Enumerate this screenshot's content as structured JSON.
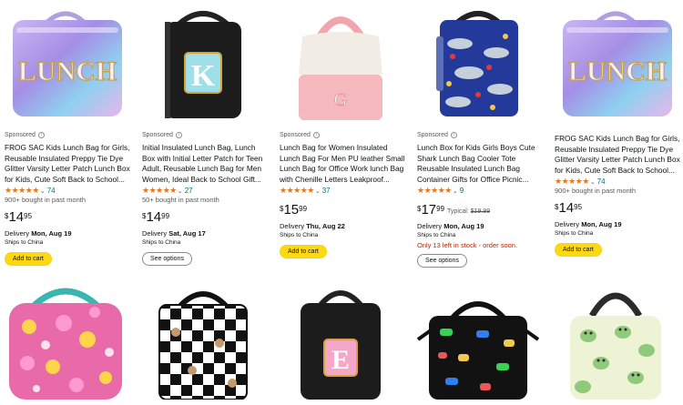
{
  "products": [
    {
      "sponsored": "Sponsored",
      "title": "FROG SAC Kids Lunch Bag for Girls, Reusable Insulated Preppy Tie Dye Glitter Varsity Letter Patch Lunch Box for Kids, Cute Soft Back to School...",
      "stars": "★★★★★",
      "rating": 4.5,
      "reviews": "74",
      "bought": "900+ bought in past month",
      "price_currency": "$",
      "price_whole": "14",
      "price_fraction": "95",
      "typical_label": "",
      "typical_price": "",
      "delivery_label": "Delivery",
      "delivery_date": "Mon, Aug 19",
      "ships": "Ships to China",
      "stock": "",
      "button": "Add to cart"
    },
    {
      "sponsored": "Sponsored",
      "title": "Initial Insulated Lunch Bag, Lunch Box with Initial Letter Patch for Teen Adult, Reusable Lunch Bag for Men Women, Ideal Back to School Gift...",
      "stars": "★★★★★",
      "rating": 4.5,
      "reviews": "27",
      "bought": "50+ bought in past month",
      "price_currency": "$",
      "price_whole": "14",
      "price_fraction": "99",
      "typical_label": "",
      "typical_price": "",
      "delivery_label": "Delivery",
      "delivery_date": "Sat, Aug 17",
      "ships": "Ships to China",
      "stock": "",
      "button": "See options"
    },
    {
      "sponsored": "Sponsored",
      "title": "Lunch Bag for Women Insulated Lunch Bag For Men PU leather Small Lunch Bag for Office Work lunch Bag with Chenille Letters Leakproof...",
      "stars": "★★★★★",
      "rating": 4,
      "reviews": "37",
      "bought": "",
      "price_currency": "$",
      "price_whole": "15",
      "price_fraction": "99",
      "typical_label": "",
      "typical_price": "",
      "delivery_label": "Delivery",
      "delivery_date": "Thu, Aug 22",
      "ships": "Ships to China",
      "stock": "",
      "button": "Add to cart"
    },
    {
      "sponsored": "Sponsored",
      "title": "Lunch Box for Kids Girls Boys Cute Shark Lunch Bag Cooler Tote Reusable Insulated Lunch Bag Container Gifts for Office Picnic...",
      "stars": "★★★★★",
      "rating": 4.5,
      "reviews": "9",
      "bought": "",
      "price_currency": "$",
      "price_whole": "17",
      "price_fraction": "99",
      "typical_label": "Typical:",
      "typical_price": "$19.99",
      "delivery_label": "Delivery",
      "delivery_date": "Mon, Aug 19",
      "ships": "Ships to China",
      "stock": "Only 13 left in stock - order soon.",
      "button": "See options"
    },
    {
      "sponsored": "",
      "title": "FROG SAC Kids Lunch Bag for Girls, Reusable Insulated Preppy Tie Dye Glitter Varsity Letter Patch Lunch Box for Kids, Cute Soft Back to School...",
      "stars": "★★★★★",
      "rating": 4.5,
      "reviews": "74",
      "bought": "900+ bought in past month",
      "price_currency": "$",
      "price_whole": "14",
      "price_fraction": "95",
      "typical_label": "",
      "typical_price": "",
      "delivery_label": "Delivery",
      "delivery_date": "Mon, Aug 19",
      "ships": "Ships to China",
      "stock": "",
      "button": "Add to cart"
    }
  ],
  "images": {
    "lunch_text": "LUNCH",
    "k_letter": "K",
    "g_letter": "G",
    "e_letter": "E"
  },
  "colors": {
    "cart_button": "#ffd814",
    "star": "#de7921",
    "link": "#007185",
    "stock_warning": "#b12704"
  }
}
